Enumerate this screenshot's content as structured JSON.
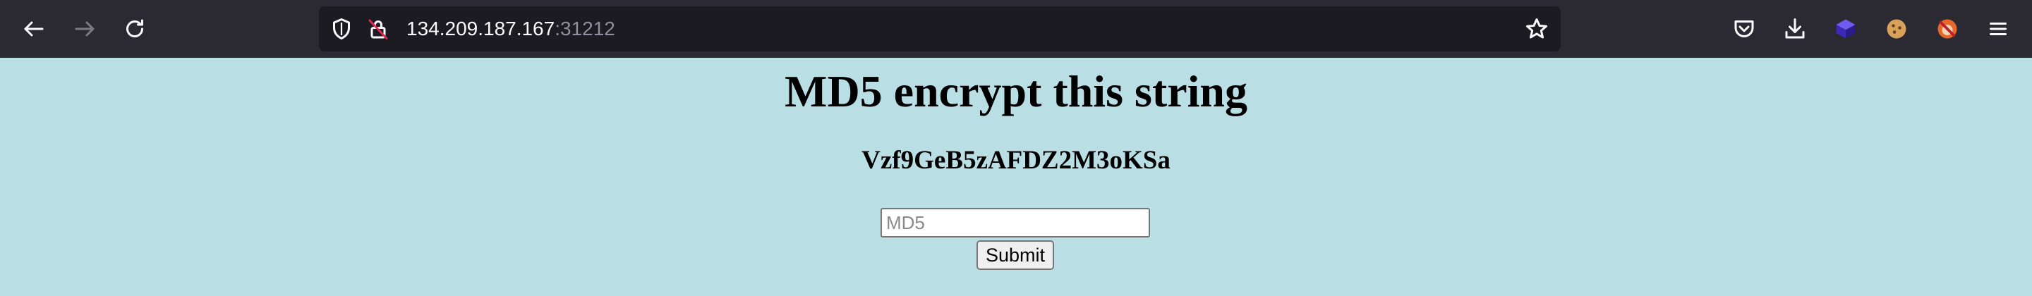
{
  "browser": {
    "url_host": "134.209.187.167",
    "url_port": ":31212",
    "toolbar_bg": "#2b2a33",
    "urlbar_bg": "#1c1b22",
    "icons": {
      "back": "back-arrow-icon",
      "forward": "forward-arrow-icon",
      "reload": "reload-icon",
      "tracking": "shield-icon",
      "insecure": "insecure-lock-icon",
      "bookmark": "star-icon",
      "pocket": "pocket-icon",
      "downloads": "download-icon",
      "ext1": "extension-cube-icon",
      "ext2": "cookie-icon",
      "ext3": "extension-fox-icon",
      "menu": "hamburger-menu-icon"
    }
  },
  "page": {
    "bg": "#b9dfe5",
    "heading": "MD5 encrypt this string",
    "challenge_string": "Vzf9GeB5zAFDZ2M3oKSa",
    "input_placeholder": "MD5",
    "input_value": "",
    "submit_label": "Submit"
  }
}
